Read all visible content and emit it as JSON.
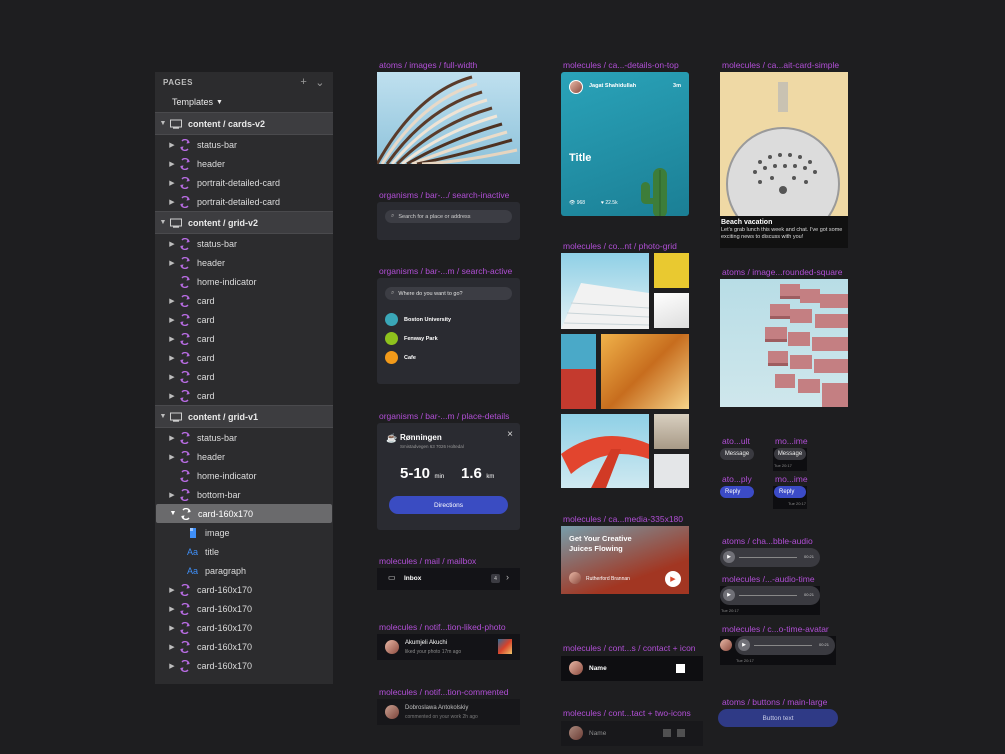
{
  "panel": {
    "title": "PAGES",
    "add": "+",
    "collapse": "⌄",
    "templates": "Templates",
    "rows": [
      {
        "type": "group",
        "label": "content / cards-v2",
        "indent": 0
      },
      {
        "type": "sym",
        "label": "status-bar",
        "tri": true
      },
      {
        "type": "sym",
        "label": "header",
        "tri": true
      },
      {
        "type": "sym",
        "label": "portrait-detailed-card",
        "tri": true
      },
      {
        "type": "sym",
        "label": "portrait-detailed-card",
        "tri": true
      },
      {
        "type": "group",
        "label": "content / grid-v2"
      },
      {
        "type": "sym",
        "label": "status-bar",
        "tri": true
      },
      {
        "type": "sym",
        "label": "header",
        "tri": true
      },
      {
        "type": "sym",
        "label": "home-indicator",
        "tri": false
      },
      {
        "type": "sym",
        "label": "card",
        "tri": true
      },
      {
        "type": "sym",
        "label": "card",
        "tri": true
      },
      {
        "type": "sym",
        "label": "card",
        "tri": true
      },
      {
        "type": "sym",
        "label": "card",
        "tri": true
      },
      {
        "type": "sym",
        "label": "card",
        "tri": true
      },
      {
        "type": "sym",
        "label": "card",
        "tri": true
      },
      {
        "type": "group",
        "label": "content / grid-v1"
      },
      {
        "type": "sym",
        "label": "status-bar",
        "tri": true
      },
      {
        "type": "sym",
        "label": "header",
        "tri": true
      },
      {
        "type": "sym",
        "label": "home-indicator",
        "tri": false
      },
      {
        "type": "sym",
        "label": "bottom-bar",
        "tri": true
      },
      {
        "type": "selected",
        "label": "card-160x170"
      },
      {
        "type": "img",
        "label": "image"
      },
      {
        "type": "text",
        "label": "title",
        "glyph": "Aa"
      },
      {
        "type": "text",
        "label": "paragraph",
        "glyph": "Aa"
      },
      {
        "type": "sym",
        "label": "card-160x170",
        "tri": true
      },
      {
        "type": "sym",
        "label": "card-160x170",
        "tri": true
      },
      {
        "type": "sym",
        "label": "card-160x170",
        "tri": true
      },
      {
        "type": "sym",
        "label": "card-160x170",
        "tri": true
      },
      {
        "type": "sym",
        "label": "card-160x170",
        "tri": true
      }
    ]
  },
  "labels": {
    "a1": "atoms / images / full-width",
    "a2": "organisms / bar-.../ search-inactive",
    "a3": "organisms / bar-...m / search-active",
    "a4": "organisms / bar-...m / place-details",
    "a5": "molecules / mail / mailbox",
    "a6": "molecules / notif...tion-liked-photo",
    "a7": "molecules / notif...tion-commented",
    "b1": "molecules / ca...-details-on-top",
    "b2": "molecules / co...nt / photo-grid",
    "b3": "molecules / ca...media-335x180",
    "b4": "molecules / cont...s / contact + icon",
    "b5": "molecules / cont...tact + two-icons",
    "c1": "molecules / ca...ait-card-simple",
    "c2": "atoms / image...rounded-square",
    "c3": "ato...ult",
    "c4": "mo...ime",
    "c5": "ato...ply",
    "c6": "mo...ime",
    "c7": "atoms / cha...bble-audio",
    "c8": "molecules /...-audio-time",
    "c9": "molecules / c...o-time-avatar",
    "c10": "atoms / buttons / main-large"
  },
  "search_inactive": {
    "placeholder": "Search for a place or address"
  },
  "search_active": {
    "placeholder": "Where do you want to go?",
    "results": [
      "Boston University",
      "Fenway Park",
      "Cafe"
    ],
    "colors": [
      "#3aa7b8",
      "#8ec21d",
      "#f29a1a"
    ]
  },
  "place": {
    "name": "Rønningen",
    "address": "Smistadvegen 63 7026 Holtedal",
    "time": "5-10",
    "time_unit": "min",
    "dist": "1.6",
    "dist_unit": "km",
    "button": "Directions"
  },
  "mailbox": {
    "label": "Inbox",
    "count": "4"
  },
  "liked": {
    "name": "Akumjeli Akuchi",
    "sub": "liked your photo 17m ago"
  },
  "commented": {
    "name": "Dobroslawa Antokolskiy",
    "sub": "commented on your work 2h ago"
  },
  "detail_card": {
    "author": "Jagat Shahidullah",
    "time": "3m",
    "title": "Title",
    "views": "968",
    "likes": "22.5k"
  },
  "media_card": {
    "title": "Get Your Creative Juices Flowing",
    "author": "Rutherford Brannan"
  },
  "contact_icon": {
    "name": "Name"
  },
  "contact_two": {
    "name": "Name"
  },
  "simple_card": {
    "title": "Beach vacation",
    "text": "Let's grab lunch this week and chat. I've got some exciting news to discuss with you!"
  },
  "bubbles": {
    "message": "Message",
    "reply": "Reply",
    "time": "Tue 20:17"
  },
  "audio": {
    "time": "00:21",
    "stamp": "Tue 20:17"
  },
  "main_button": {
    "label": "Button text"
  }
}
